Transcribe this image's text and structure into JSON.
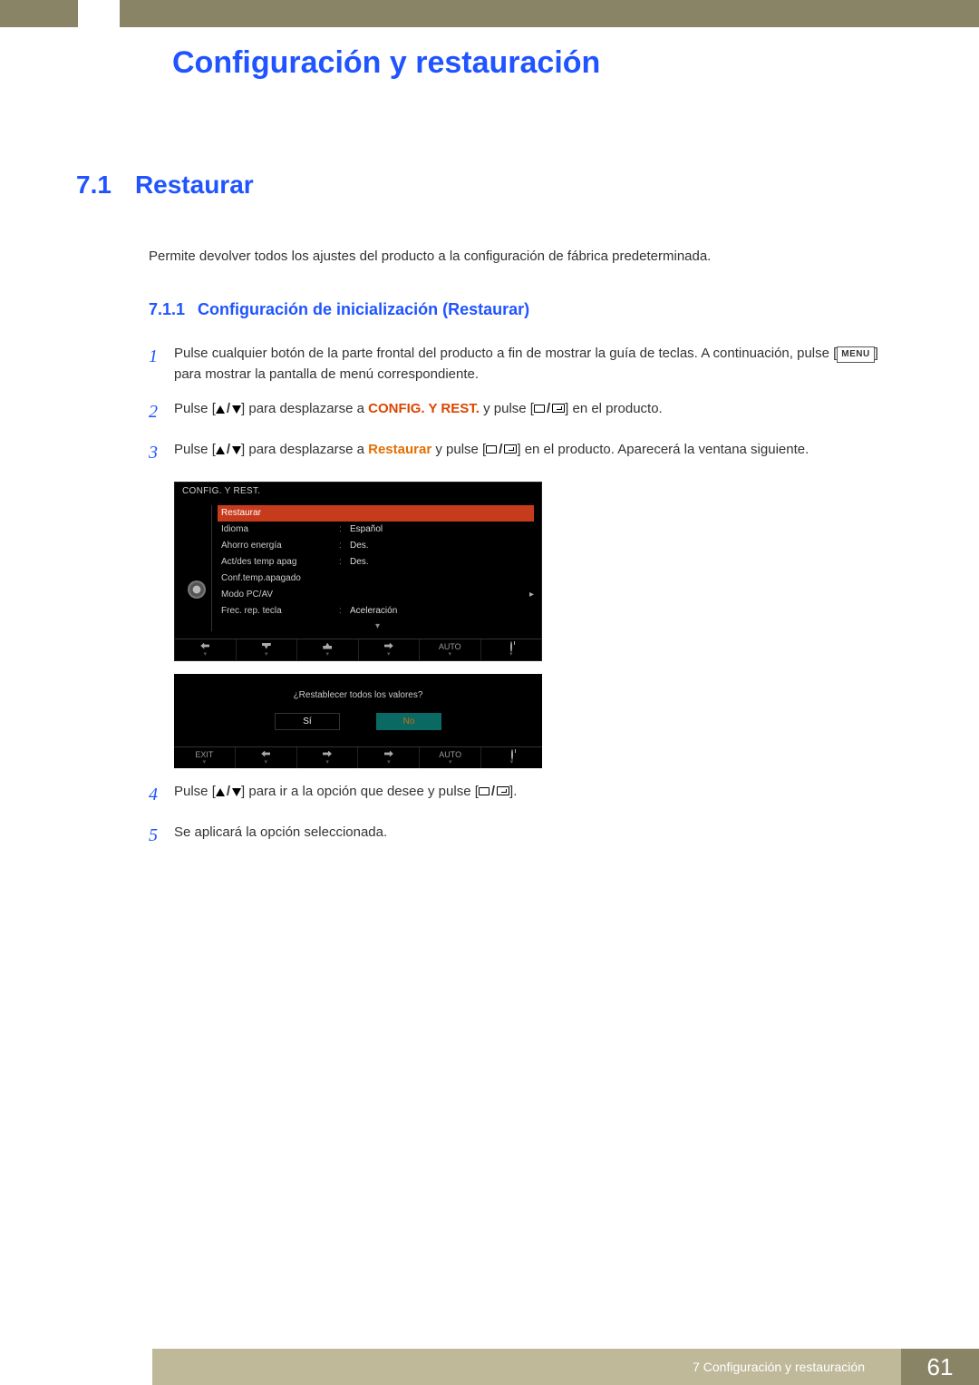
{
  "chapter": {
    "title": "Configuración y restauración"
  },
  "section": {
    "number": "7.1",
    "title": "Restaurar"
  },
  "intro": "Permite devolver todos los ajustes del producto a la configuración de fábrica predeterminada.",
  "subsection": {
    "number": "7.1.1",
    "title": "Configuración de inicialización (Restaurar)"
  },
  "menu_kbd": "MENU",
  "steps": {
    "s1": {
      "n": "1",
      "a": "Pulse cualquier botón de la parte frontal del producto a fin de mostrar la guía de teclas. A continuación, pulse [",
      "b": "] para mostrar la pantalla de menú correspondiente."
    },
    "s2": {
      "n": "2",
      "a": "Pulse [",
      "b": "] para desplazarse a ",
      "hl": "CONFIG. Y REST.",
      "c": " y pulse [",
      "d": "] en el producto."
    },
    "s3": {
      "n": "3",
      "a": "Pulse [",
      "b": "] para desplazarse a ",
      "hl": "Restaurar",
      "c": " y pulse [",
      "d": "] en el producto. Aparecerá la ventana siguiente."
    },
    "s4": {
      "n": "4",
      "a": "Pulse [",
      "b": "] para ir a la opción que desee y pulse [",
      "c": "]."
    },
    "s5": {
      "n": "5",
      "a": "Se aplicará la opción seleccionada."
    }
  },
  "osd": {
    "title": "CONFIG. Y REST.",
    "rows": [
      {
        "label": "Restaurar",
        "value": "",
        "selected": true
      },
      {
        "label": "Idioma",
        "value": "Español"
      },
      {
        "label": "Ahorro energía",
        "value": "Des."
      },
      {
        "label": "Act/des temp apag",
        "value": "Des."
      },
      {
        "label": "Conf.temp.apagado",
        "value": ""
      },
      {
        "label": "Modo PC/AV",
        "value": "",
        "caret": "▸"
      },
      {
        "label": "Frec. rep. tecla",
        "value": "Aceleración"
      }
    ],
    "nav_auto": "AUTO"
  },
  "dialog": {
    "question": "¿Restablecer todos los valores?",
    "yes": "Sí",
    "no": "No",
    "exit": "EXIT",
    "auto": "AUTO"
  },
  "footer": {
    "label": "7 Configuración y restauración",
    "page": "61"
  }
}
